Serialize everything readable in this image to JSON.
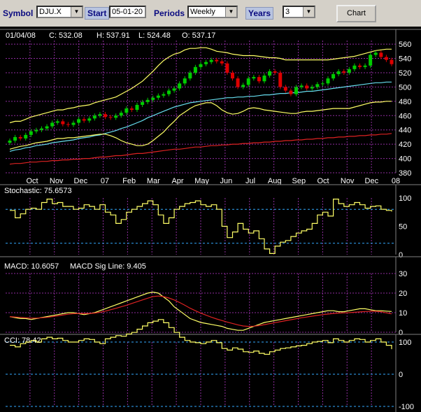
{
  "toolbar": {
    "symbol_label": "Symbol",
    "symbol_value": "DJU.X",
    "start_label": "Start",
    "start_value": "05-01-20",
    "periods_label": "Periods",
    "periods_value": "Weekly",
    "years_label": "Years",
    "years_value": "3",
    "chart_button": "Chart"
  },
  "chart_data": [
    {
      "type": "candlestick",
      "header": {
        "date": "01/04/08",
        "c": "C: 532.08",
        "h": "H: 537.91",
        "l": "L: 524.48",
        "o": "O: 537.17"
      },
      "ylim": [
        380,
        565
      ],
      "y_ticks": [
        "380",
        "400",
        "420",
        "440",
        "460",
        "480",
        "500",
        "520",
        "540",
        "560"
      ],
      "x_ticks": [
        "Oct",
        "Nov",
        "Dec",
        "07",
        "Feb",
        "Mar",
        "Apr",
        "May",
        "Jun",
        "Jul",
        "Aug",
        "Sep",
        "Oct",
        "Nov",
        "Dec",
        "08"
      ],
      "colors": {
        "up": "#00cc00",
        "down": "#dd0000",
        "bands": "#ffff66",
        "ma_short": "#66ddee",
        "ma_long": "#dd2222",
        "grid": "#8e2c9e"
      },
      "close": [
        425,
        430,
        428,
        433,
        438,
        440,
        442,
        445,
        450,
        452,
        448,
        447,
        450,
        455,
        453,
        456,
        460,
        462,
        458,
        457,
        460,
        464,
        470,
        468,
        475,
        479,
        482,
        485,
        488,
        490,
        495,
        498,
        505,
        512,
        520,
        528,
        532,
        535,
        538,
        536,
        533,
        520,
        512,
        500,
        503,
        512,
        514,
        508,
        516,
        522,
        520,
        500,
        495,
        490,
        500,
        502,
        498,
        500,
        504,
        505,
        512,
        518,
        522,
        520,
        525,
        530,
        528,
        530,
        545,
        548,
        542,
        538,
        532
      ],
      "upper_band": [
        450,
        452,
        452,
        455,
        458,
        460,
        462,
        464,
        466,
        468,
        468,
        470,
        471,
        473,
        474,
        475,
        478,
        480,
        482,
        484,
        486,
        490,
        494,
        498,
        503,
        508,
        515,
        522,
        530,
        537,
        542,
        546,
        548,
        552,
        554,
        554,
        555,
        555,
        553,
        550,
        549,
        548,
        546,
        545,
        544,
        544,
        544,
        543,
        542,
        541,
        541,
        540,
        538,
        538,
        538,
        538,
        538,
        538,
        538,
        538,
        538,
        539,
        540,
        541,
        542,
        543,
        545,
        547,
        549,
        551,
        552,
        553,
        553
      ],
      "lower_band": [
        413,
        415,
        417,
        418,
        420,
        422,
        423,
        424,
        426,
        428,
        428,
        429,
        429,
        430,
        431,
        432,
        433,
        434,
        434,
        432,
        429,
        425,
        422,
        420,
        418,
        418,
        420,
        425,
        431,
        437,
        445,
        452,
        460,
        465,
        470,
        474,
        476,
        478,
        478,
        474,
        468,
        464,
        462,
        463,
        466,
        470,
        471,
        470,
        468,
        467,
        466,
        465,
        464,
        463,
        463,
        465,
        466,
        466,
        467,
        468,
        469,
        470,
        470,
        470,
        470,
        472,
        474,
        476,
        478,
        479,
        479,
        480,
        480
      ],
      "ma_short": [
        410,
        412,
        413,
        415,
        416,
        418,
        419,
        420,
        422,
        423,
        424,
        425,
        426,
        428,
        429,
        430,
        432,
        433,
        435,
        437,
        439,
        442,
        444,
        447,
        450,
        453,
        457,
        460,
        463,
        466,
        469,
        472,
        474,
        476,
        478,
        479,
        480,
        481,
        482,
        483,
        484,
        485,
        485,
        486,
        486,
        487,
        487,
        488,
        489,
        489,
        490,
        491,
        491,
        492,
        492,
        493,
        494,
        494,
        495,
        496,
        497,
        498,
        499,
        500,
        501,
        502,
        503,
        504,
        505,
        506,
        506,
        507,
        507
      ],
      "ma_long": [
        392,
        393,
        393,
        394,
        395,
        395,
        396,
        396,
        397,
        397,
        398,
        398,
        399,
        399,
        400,
        400,
        401,
        402,
        402,
        403,
        404,
        404,
        405,
        406,
        407,
        407,
        408,
        409,
        410,
        411,
        412,
        413,
        413,
        414,
        415,
        416,
        416,
        417,
        418,
        418,
        419,
        419,
        420,
        420,
        421,
        421,
        422,
        422,
        423,
        423,
        424,
        424,
        425,
        425,
        426,
        426,
        427,
        427,
        428,
        428,
        429,
        429,
        430,
        430,
        431,
        431,
        432,
        432,
        433,
        433,
        434,
        434,
        435
      ]
    },
    {
      "type": "line",
      "title": "Stochastic: 75.6573",
      "ylim": [
        0,
        100
      ],
      "y_ticks": [
        "0",
        "50",
        "100"
      ],
      "ref_lines": [
        20,
        80
      ],
      "values": [
        78,
        65,
        72,
        80,
        82,
        80,
        92,
        98,
        90,
        92,
        85,
        85,
        80,
        82,
        88,
        85,
        80,
        88,
        75,
        70,
        55,
        62,
        75,
        80,
        85,
        90,
        95,
        88,
        70,
        55,
        65,
        80,
        85,
        90,
        92,
        95,
        88,
        85,
        88,
        80,
        50,
        30,
        40,
        55,
        45,
        38,
        42,
        28,
        10,
        2,
        15,
        22,
        25,
        32,
        38,
        42,
        45,
        55,
        70,
        75,
        68,
        98,
        90,
        85,
        88,
        92,
        88,
        82,
        85,
        86,
        80,
        78,
        76
      ],
      "color": "#ffff66"
    },
    {
      "type": "line",
      "title": "MACD: 10.6057",
      "subtitle": "MACD Sig Line: 9.405",
      "ylim": [
        0,
        30
      ],
      "y_ticks": [
        "0",
        "10",
        "20",
        "30"
      ],
      "series": [
        {
          "name": "MACD",
          "color": "#ffff66",
          "values": [
            8,
            7.5,
            7,
            7,
            6.5,
            7,
            7.5,
            8,
            8.5,
            9,
            9.5,
            10,
            10,
            9.5,
            9,
            9.5,
            10,
            11,
            12,
            13,
            14,
            15,
            16,
            17,
            18,
            19,
            20,
            20.5,
            20,
            18,
            16,
            13,
            11,
            9,
            7,
            6,
            5,
            4.5,
            4,
            3.5,
            3,
            2,
            1.5,
            1,
            1,
            2,
            3,
            4,
            5,
            5.5,
            6,
            6.5,
            7,
            7.5,
            8,
            8.5,
            9,
            9.5,
            10,
            10.5,
            11,
            11,
            10.5,
            10.5,
            11,
            11.5,
            12,
            12,
            11.5,
            11,
            11,
            10.8,
            10.6
          ]
        },
        {
          "name": "MACD Sig Line",
          "color": "#dd2222",
          "values": [
            8,
            7.8,
            7.6,
            7.4,
            7.2,
            7.2,
            7.4,
            7.6,
            8,
            8.4,
            8.8,
            9.2,
            9.5,
            9.6,
            9.6,
            9.6,
            9.8,
            10.2,
            10.8,
            11.5,
            12.2,
            13,
            13.8,
            14.7,
            15.6,
            16.5,
            17.4,
            18.2,
            18.5,
            18.2,
            17.5,
            16.5,
            15.2,
            13.8,
            12.3,
            11,
            9.8,
            8.7,
            7.7,
            6.8,
            6,
            5.2,
            4.5,
            3.8,
            3.2,
            3,
            3.1,
            3.4,
            3.9,
            4.4,
            4.9,
            5.4,
            5.9,
            6.4,
            6.9,
            7.4,
            7.8,
            8.2,
            8.6,
            9,
            9.3,
            9.6,
            9.8,
            9.9,
            10,
            10.2,
            10.4,
            10.6,
            10.7,
            10.7,
            10.5,
            9.9,
            9.4
          ]
        }
      ]
    },
    {
      "type": "line",
      "title": "CCI: 78.42",
      "ylim": [
        -100,
        100
      ],
      "y_ticks": [
        "-100",
        "0",
        "100"
      ],
      "ref_lines": [
        -100,
        0,
        100
      ],
      "values": [
        90,
        85,
        95,
        100,
        105,
        100,
        110,
        115,
        110,
        112,
        105,
        100,
        100,
        105,
        110,
        108,
        100,
        95,
        110,
        115,
        120,
        118,
        125,
        130,
        140,
        150,
        160,
        165,
        170,
        160,
        145,
        130,
        115,
        105,
        100,
        98,
        95,
        100,
        105,
        98,
        80,
        75,
        82,
        78,
        70,
        68,
        72,
        65,
        62,
        70,
        75,
        80,
        82,
        85,
        88,
        90,
        95,
        100,
        102,
        105,
        98,
        110,
        105,
        100,
        105,
        110,
        108,
        100,
        105,
        110,
        100,
        90,
        78
      ],
      "color": "#ffff66"
    }
  ]
}
